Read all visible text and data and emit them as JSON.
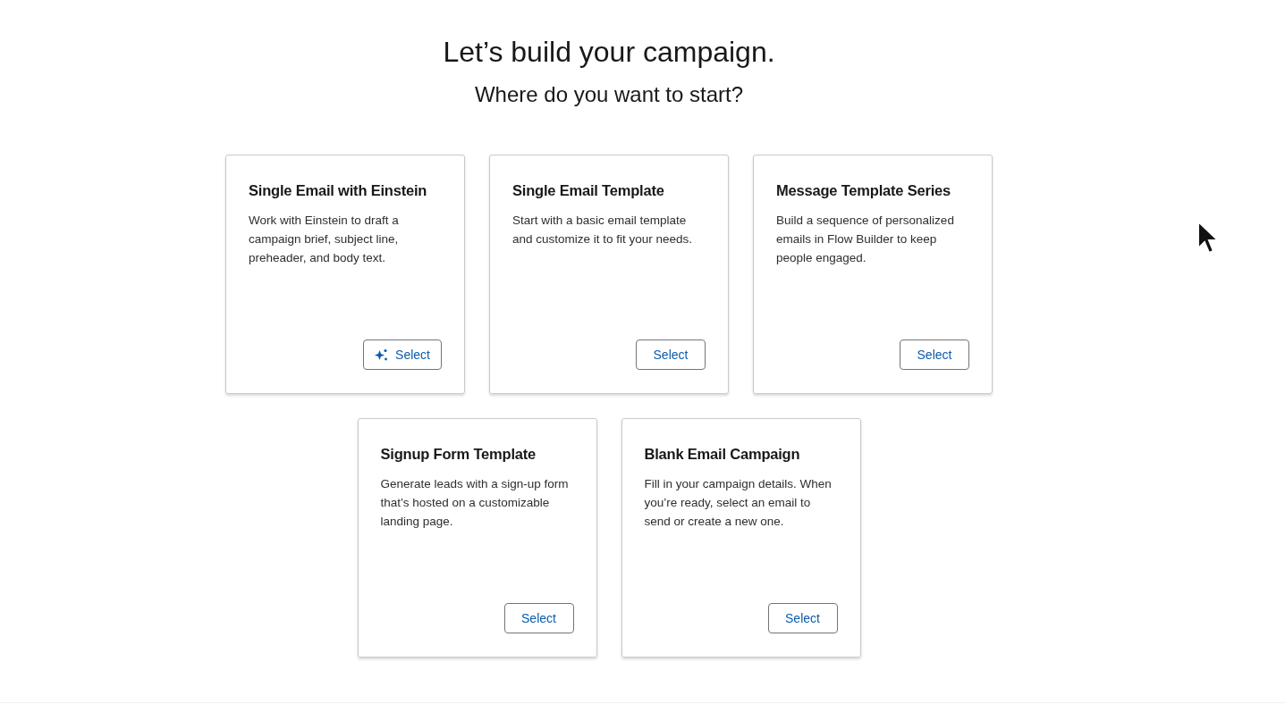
{
  "heading": "Let’s build your campaign.",
  "subheading": "Where do you want to start?",
  "cards": [
    {
      "kind": "ai",
      "title": "Single Email with Einstein",
      "description": "Work with Einstein to draft a campaign brief, subject line, preheader, and body text.",
      "button": "Select"
    },
    {
      "kind": "plain",
      "title": "Single Email Template",
      "description": "Start with a basic email template and customize it to fit your needs.",
      "button": "Select"
    },
    {
      "kind": "plain",
      "title": "Message Template Series",
      "description": "Build a sequence of personalized emails in Flow Builder to keep people engaged.",
      "button": "Select"
    },
    {
      "kind": "plain",
      "title": "Signup Form Template",
      "description": "Generate leads with a sign-up form that’s hosted on a customizable landing page.",
      "button": "Select"
    },
    {
      "kind": "plain",
      "title": "Blank Email Campaign",
      "description": "Fill in your campaign details. When you’re ready, select an email to send or create a new one.",
      "button": "Select"
    }
  ]
}
